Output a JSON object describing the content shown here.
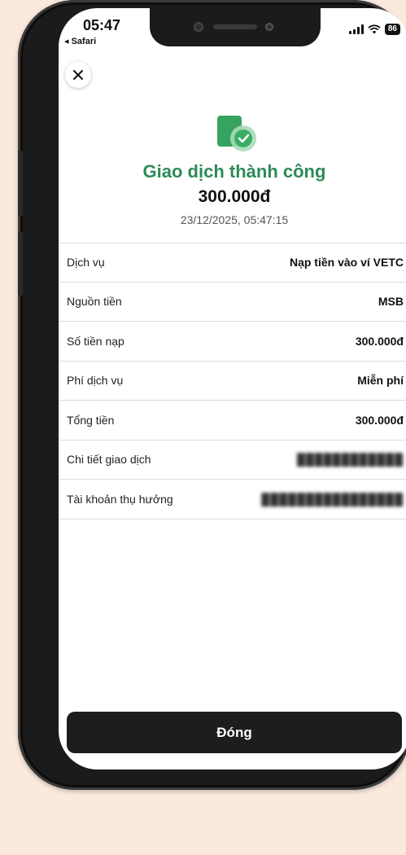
{
  "status_bar": {
    "time": "05:47",
    "back_app": "◂ Safari",
    "battery": "86"
  },
  "header": {
    "close_icon": "close-icon"
  },
  "result": {
    "icon": "success-check-icon",
    "title": "Giao dịch thành công",
    "amount": "300.000đ",
    "datetime": "23/12/2025, 05:47:15",
    "accent_color": "#2e8b57"
  },
  "details": [
    {
      "label": "Dịch vụ",
      "value": "Nạp tiền vào ví VETC"
    },
    {
      "label": "Nguồn tiền",
      "value": "MSB"
    },
    {
      "label": "Số tiền nạp",
      "value": "300.000đ"
    },
    {
      "label": "Phí dịch vụ",
      "value": "Miễn phí"
    },
    {
      "label": "Tổng tiền",
      "value": "300.000đ"
    },
    {
      "label": "Chi tiết giao dịch",
      "value": "",
      "blurred": true
    },
    {
      "label": "Tài khoản thụ hưởng",
      "value": "",
      "blurred": true
    }
  ],
  "footer": {
    "close_label": "Đóng"
  }
}
